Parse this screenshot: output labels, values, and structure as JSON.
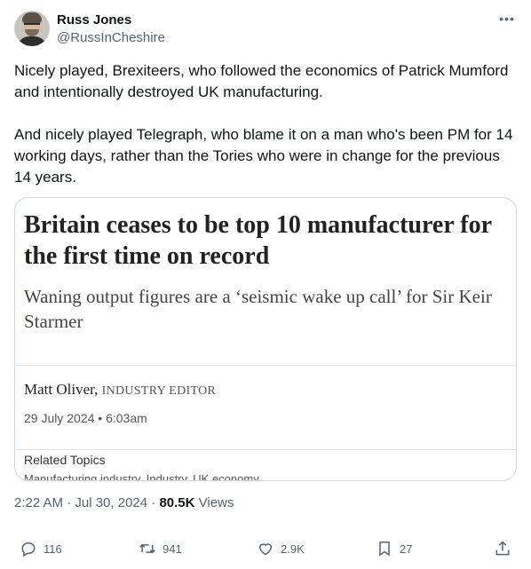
{
  "author": {
    "display_name": "Russ Jones",
    "handle": "@RussInCheshire"
  },
  "tweet": {
    "text": "Nicely played, Brexiteers, who followed the economics of Patrick Mumford and intentionally destroyed UK manufacturing.\n\nAnd nicely played Telegraph, who blame it on a man who's been PM for 14 working days, rather than the Tories who were in change for the previous 14 years."
  },
  "card": {
    "headline": "Britain ceases to be top 10 manufacturer for the first time on record",
    "standfirst": "Waning output figures are a ‘seismic wake up call’ for Sir Keir Starmer",
    "author": "Matt Oliver,",
    "author_role": "INDUSTRY EDITOR",
    "date": "29 July 2024 • 6:03am",
    "related_label": "Related Topics",
    "related_items": "Manufacturing industry, Industry, UK economy"
  },
  "meta": {
    "time": "2:22 AM · Jul 30, 2024 · ",
    "views_count": "80.5K",
    "views_label": " Views"
  },
  "actions": {
    "replies": "116",
    "retweets": "941",
    "likes": "2.9K",
    "bookmarks": "27"
  },
  "icons": {
    "more": "more-icon",
    "reply": "reply-icon",
    "retweet": "retweet-icon",
    "like": "heart-icon",
    "bookmark": "bookmark-icon",
    "share": "share-icon"
  },
  "colors": {
    "text": "#0f1419",
    "secondary": "#536471",
    "border": "#cfd9de"
  }
}
